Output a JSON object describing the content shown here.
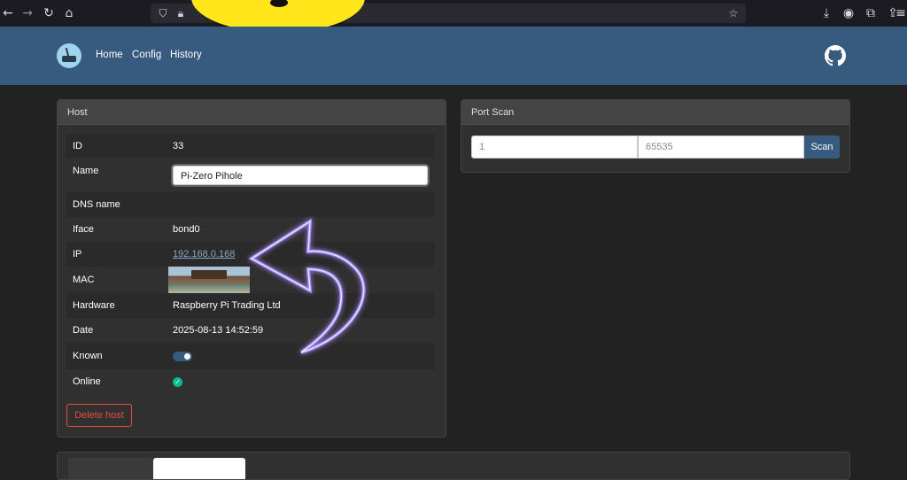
{
  "browser": {
    "nav_icons": [
      "back-icon",
      "forward-icon",
      "reload-icon",
      "home-icon"
    ],
    "right_icons": [
      "download-icon",
      "account-icon",
      "extensions-icon",
      "share-icon",
      "menu-icon"
    ]
  },
  "navbar": {
    "links": [
      "Home",
      "Config",
      "History"
    ],
    "logo": "router-logo",
    "github_icon": "github-icon"
  },
  "host_card": {
    "title": "Host",
    "rows": {
      "id": {
        "label": "ID",
        "value": "33"
      },
      "name": {
        "label": "Name",
        "value": "Pi-Zero Pihole"
      },
      "dns": {
        "label": "DNS name",
        "value": ""
      },
      "iface": {
        "label": "Iface",
        "value": "bond0"
      },
      "ip": {
        "label": "IP",
        "value": "192.168.0.168"
      },
      "mac": {
        "label": "MAC",
        "value": ""
      },
      "hardware": {
        "label": "Hardware",
        "value": "Raspberry Pi Trading Ltd"
      },
      "date": {
        "label": "Date",
        "value": "2025-08-13 14:52:59"
      },
      "known": {
        "label": "Known",
        "enabled": true
      },
      "online": {
        "label": "Online",
        "status": true
      }
    },
    "delete_label": "Delete host"
  },
  "port_scan": {
    "title": "Port Scan",
    "from_placeholder": "1",
    "to_placeholder": "65535",
    "scan_label": "Scan"
  },
  "colors": {
    "navbar": "#375a7f",
    "background": "#222222",
    "card": "#303030",
    "danger": "#e74c3c",
    "success": "#00bc8c"
  }
}
